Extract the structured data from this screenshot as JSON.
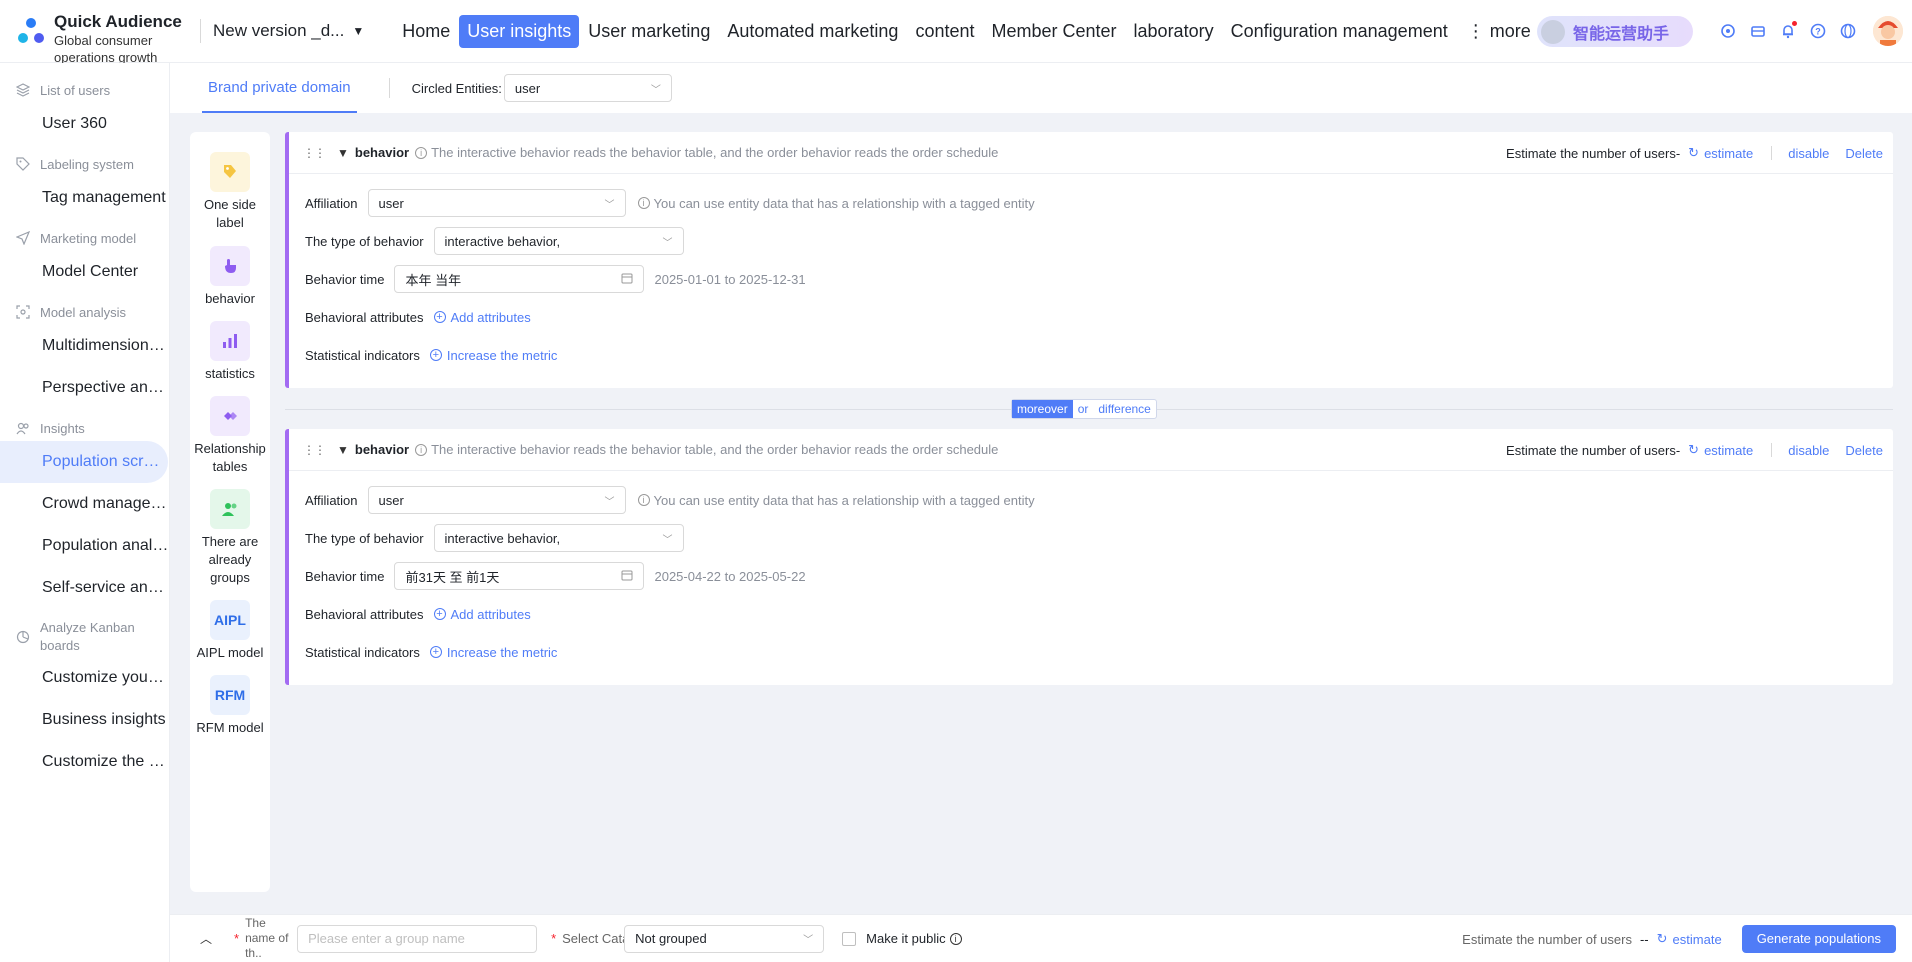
{
  "app": {
    "name": "Quick Audience",
    "subtitle": "Global consumer operations growth",
    "version": "New version _d..."
  },
  "nav": {
    "items": [
      "Home",
      "User insights",
      "User marketing",
      "Automated marketing",
      "content",
      "Member Center",
      "laboratory",
      "Configuration management"
    ],
    "active": "User insights",
    "more": "⋮ more"
  },
  "assistant": {
    "label": "智能运营助手"
  },
  "sidebar": {
    "groups": [
      {
        "title": "List of users",
        "items": [
          "User 360"
        ]
      },
      {
        "title": "Labeling system",
        "items": [
          "Tag management"
        ]
      },
      {
        "title": "Marketing model",
        "items": [
          "Model Center"
        ]
      },
      {
        "title": "Model analysis",
        "items": [
          "Multidimensional...",
          "Perspective analy..."
        ]
      },
      {
        "title": "Insights",
        "items": [
          "Population scree...",
          "Crowd managem...",
          "Population analy...",
          "Self-service analy..."
        ]
      },
      {
        "title": "Analyze Kanban boards",
        "items": [
          "Customize your ...",
          "Business insights",
          "Customize the m..."
        ]
      }
    ],
    "active": "Population scree..."
  },
  "subheader": {
    "tab": "Brand private domain",
    "circled_label": "Circled Entities:",
    "circled_value": "user"
  },
  "toolbox": [
    {
      "label": "One side label",
      "icon": "tag-icon",
      "color": "#f5c542",
      "bg": "#fdf5dc"
    },
    {
      "label": "behavior",
      "icon": "hand-pointer-icon",
      "color": "#8e5cf0",
      "bg": "#f1eafd"
    },
    {
      "label": "statistics",
      "icon": "bar-chart-icon",
      "color": "#8e5cf0",
      "bg": "#f1eafd"
    },
    {
      "label": "Relationship tables",
      "icon": "link-icon",
      "color": "#8e5cf0",
      "bg": "#f1eafd"
    },
    {
      "label": "There are already groups",
      "icon": "group-icon",
      "color": "#2fc25b",
      "bg": "#e4f7ea"
    },
    {
      "label": "AIPL model",
      "icon": "AIPL",
      "color": "#2f6ee8",
      "bg": "#eaf1fd"
    },
    {
      "label": "RFM model",
      "icon": "RFM",
      "color": "#2f6ee8",
      "bg": "#eaf1fd"
    }
  ],
  "cards": [
    {
      "title": "behavior",
      "desc": "The interactive behavior reads the behavior table, and the order behavior reads the order schedule",
      "estimate_label": "Estimate the number of users-",
      "estimate": "estimate",
      "disable": "disable",
      "delete": "Delete",
      "affiliation_label": "Affiliation",
      "affiliation": "user",
      "affiliation_hint": "You can use entity data that has a relationship with a tagged entity",
      "type_label": "The type of behavior",
      "type": "interactive behavior,",
      "time_label": "Behavior time",
      "time": "本年 当年",
      "time_range": "2025-01-01 to 2025-12-31",
      "attr_label": "Behavioral attributes",
      "attr_link": "Add attributes",
      "metric_label": "Statistical indicators",
      "metric_link": "Increase the metric"
    },
    {
      "title": "behavior",
      "desc": "The interactive behavior reads the behavior table, and the order behavior reads the order schedule",
      "estimate_label": "Estimate the number of users-",
      "estimate": "estimate",
      "disable": "disable",
      "delete": "Delete",
      "affiliation_label": "Affiliation",
      "affiliation": "user",
      "affiliation_hint": "You can use entity data that has a relationship with a tagged entity",
      "type_label": "The type of behavior",
      "type": "interactive behavior,",
      "time_label": "Behavior time",
      "time": "前31天 至 前1天",
      "time_range": "2025-04-22 to 2025-05-22",
      "attr_label": "Behavioral attributes",
      "attr_link": "Add attributes",
      "metric_label": "Statistical indicators",
      "metric_link": "Increase the metric"
    }
  ],
  "connector": {
    "options": [
      "moreover",
      "or",
      "difference"
    ],
    "selected": "moreover"
  },
  "footer": {
    "name_label": "The name of th..",
    "name_placeholder": "Please enter a group name",
    "catalog_label": "Select Catalog",
    "catalog_value": "Not grouped",
    "public_label": "Make it public",
    "estimate_label": "Estimate the number of users",
    "estimate_value": "--",
    "estimate": "estimate",
    "generate": "Generate populations"
  }
}
